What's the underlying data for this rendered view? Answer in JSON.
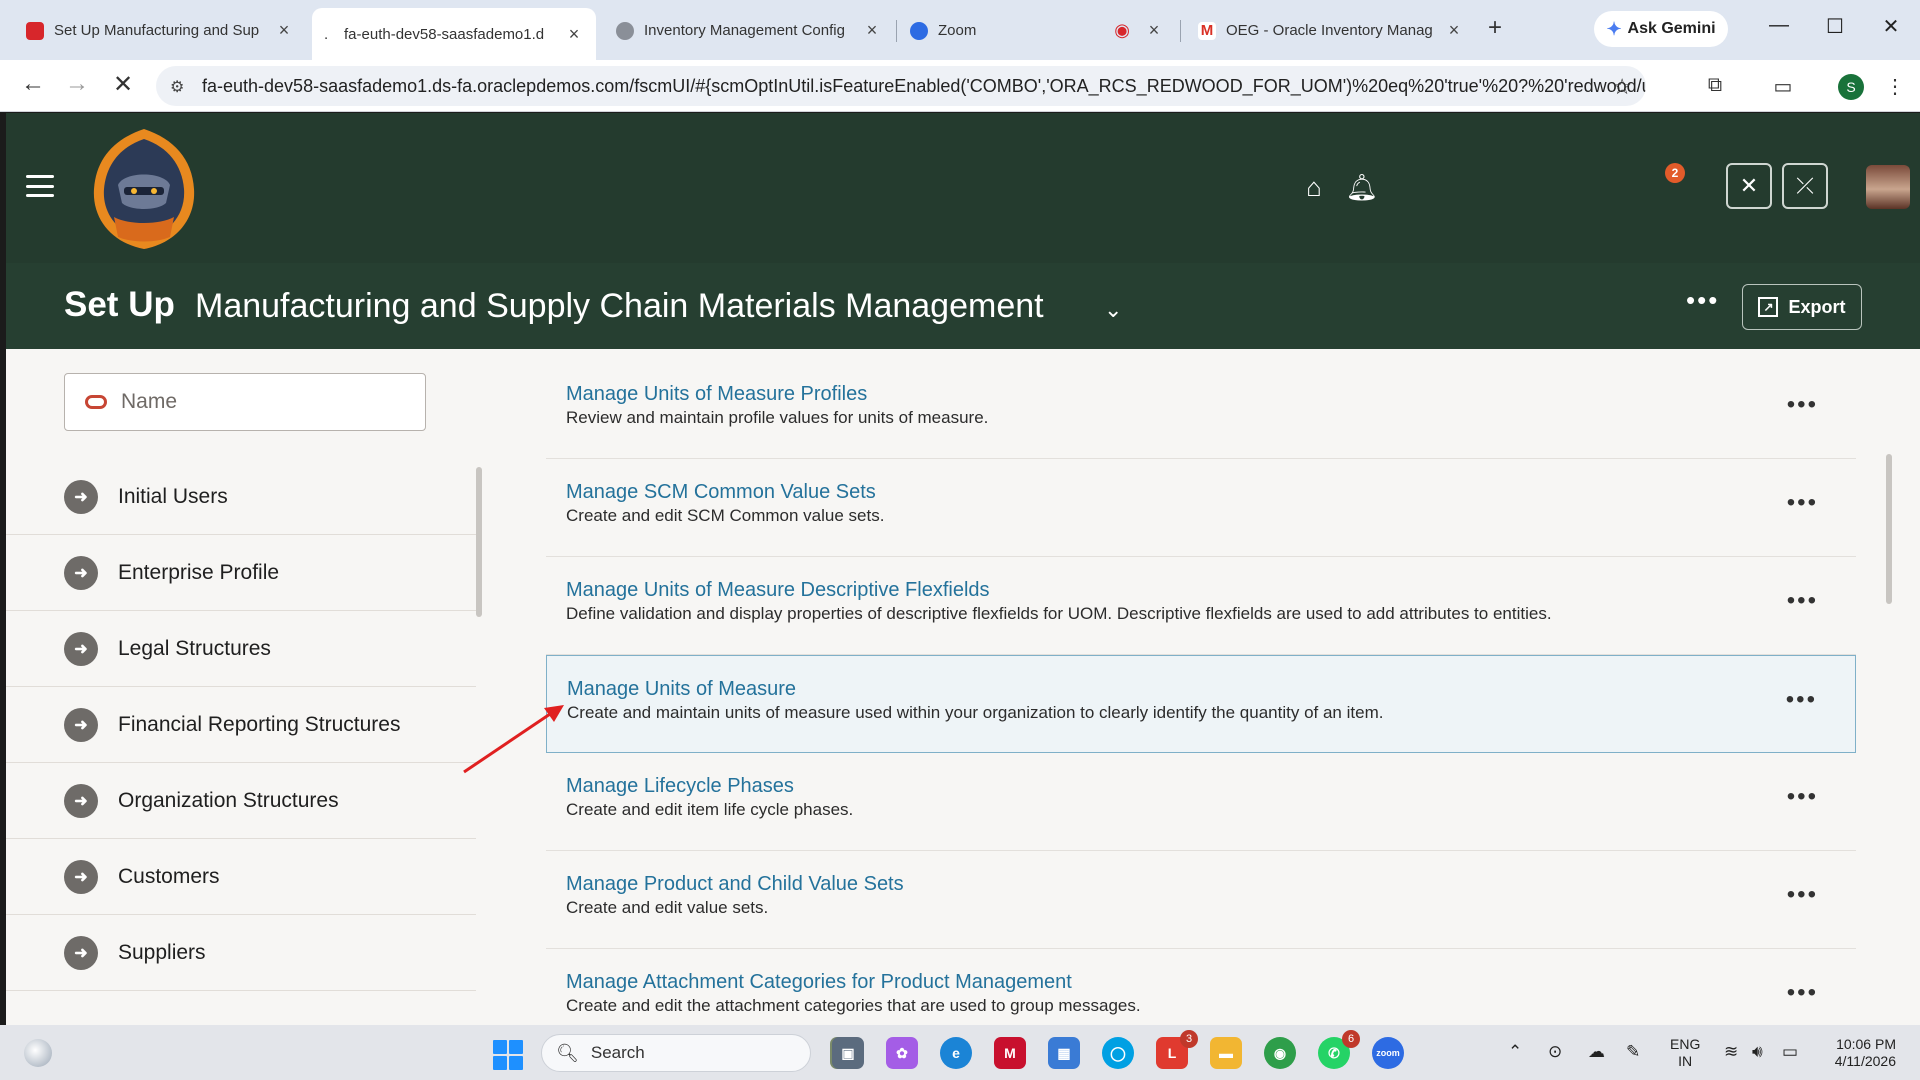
{
  "browser": {
    "tabs": [
      {
        "title": "Set Up Manufacturing and Sup",
        "favicon_color": "#d7262b"
      },
      {
        "title": "fa-euth-dev58-saasfademo1.d",
        "favicon_color": "#ffffff"
      },
      {
        "title": "Inventory Management Config",
        "favicon_color": "#8a8f98"
      },
      {
        "title": "Zoom",
        "favicon_color": "#2d6be3"
      },
      {
        "title": "OEG - Oracle Inventory Manag",
        "favicon_color": "#ffffff"
      }
    ],
    "active_tab_prefix": ".",
    "new_tab": "+",
    "gemini_label": "Ask Gemini",
    "url": "fa-euth-dev58-saasfademo1.ds-fa.oraclepdemos.com/fscmUI/#{scmOptInUtil.isFeatureEnabled('COMBO','ORA_RCS_REDWOOD_FOR_UOM')%20eq%20'true'%20?%20'redwood/uom/...",
    "profile_initial": "S"
  },
  "app": {
    "notification_count": "2",
    "title_prefix": "Set Up",
    "offering": "Manufacturing and Supply Chain Materials Management",
    "export_label": "Export",
    "search_placeholder": "Name"
  },
  "left_tasks": [
    {
      "label": "Initial Users"
    },
    {
      "label": "Enterprise Profile"
    },
    {
      "label": "Legal Structures"
    },
    {
      "label": "Financial Reporting Structures"
    },
    {
      "label": "Organization Structures"
    },
    {
      "label": "Customers"
    },
    {
      "label": "Suppliers"
    }
  ],
  "right_tasks": [
    {
      "title": "Manage Units of Measure Profiles",
      "desc": "Review and maintain profile values for units of measure."
    },
    {
      "title": "Manage SCM Common Value Sets",
      "desc": "Create and edit SCM Common value sets."
    },
    {
      "title": "Manage Units of Measure Descriptive Flexfields",
      "desc": "Define validation and display properties of descriptive flexfields for UOM. Descriptive flexfields are used to add attributes to entities."
    },
    {
      "title": "Manage Units of Measure",
      "desc": "Create and maintain units of measure used within your organization to clearly identify the quantity of an item."
    },
    {
      "title": "Manage Lifecycle Phases",
      "desc": "Create and edit item life cycle phases."
    },
    {
      "title": "Manage Product and Child Value Sets",
      "desc": "Create and edit value sets."
    },
    {
      "title": "Manage Attachment Categories for Product Management",
      "desc": "Create and edit the attachment categories that are used to group messages."
    }
  ],
  "selected_task_index": 3,
  "taskbar": {
    "search_label": "Search",
    "badges": {
      "app_l": "3",
      "whatsapp": "6"
    },
    "lang_line1": "ENG",
    "lang_line2": "IN",
    "time": "10:06 PM",
    "date": "4/11/2026"
  },
  "colors": {
    "header_bg": "#243b2e",
    "link": "#24729b",
    "selected_border": "#7fb0c8",
    "annotation_arrow": "#e02020"
  }
}
